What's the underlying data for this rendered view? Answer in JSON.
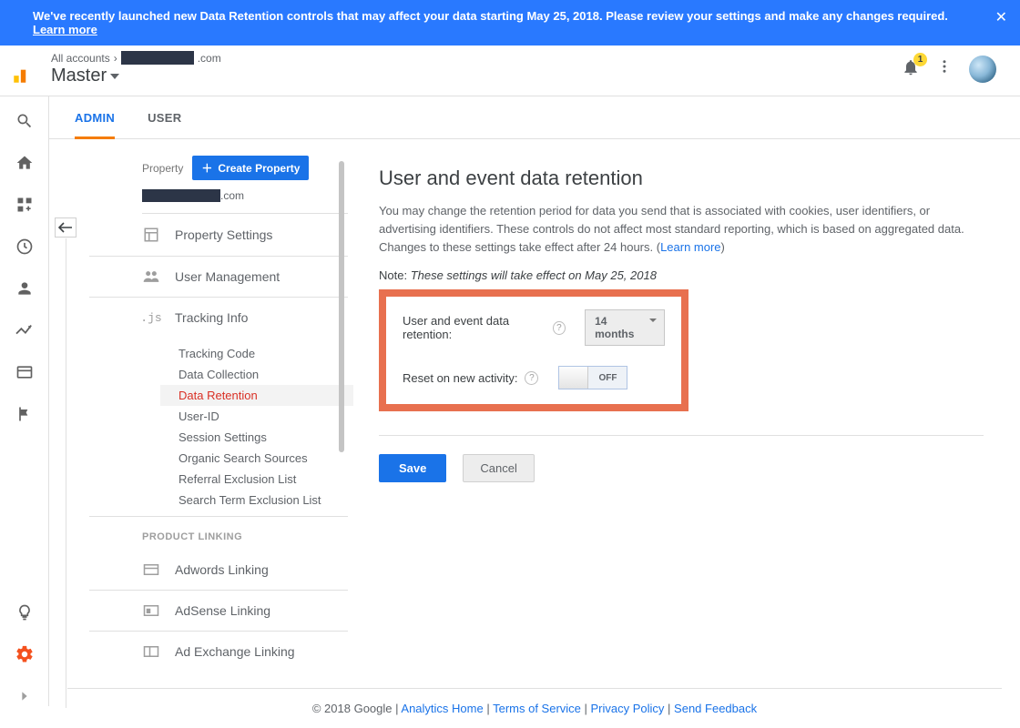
{
  "banner": {
    "text": "We've recently launched new Data Retention controls that may affect your data starting May 25, 2018. Please review your settings and make any changes required. ",
    "link": "Learn more"
  },
  "header": {
    "crumb_prefix": "All accounts",
    "crumb_suffix": ".com",
    "account": "Master",
    "notifications": "1"
  },
  "tabs": {
    "admin": "ADMIN",
    "user": "USER"
  },
  "property": {
    "label": "Property",
    "create": "Create Property",
    "domain_suffix": ".com",
    "nav": {
      "settings": "Property Settings",
      "user_mgmt": "User Management",
      "tracking": "Tracking Info",
      "tracking_sub": {
        "code": "Tracking Code",
        "collection": "Data Collection",
        "retention": "Data Retention",
        "userid": "User-ID",
        "session": "Session Settings",
        "organic": "Organic Search Sources",
        "referral": "Referral Exclusion List",
        "searchterm": "Search Term Exclusion List"
      },
      "section_linking": "PRODUCT LINKING",
      "adwords": "Adwords Linking",
      "adsense": "AdSense Linking",
      "adexchange": "Ad Exchange Linking"
    }
  },
  "content": {
    "title": "User and event data retention",
    "lead_a": "You may change the retention period for data you send that is associated with cookies, user identifiers, or advertising identifiers. These controls do not affect most standard reporting, which is based on aggregated data. Changes to these settings take effect after 24 hours. (",
    "learn_more": "Learn more",
    "lead_b": ")",
    "note_label": "Note: ",
    "note_text": "These settings will take effect on May 25, 2018",
    "row1_label": "User and event data retention:",
    "row1_value": "14 months",
    "row2_label": "Reset on new activity:",
    "row2_value": "OFF",
    "save": "Save",
    "cancel": "Cancel"
  },
  "footer": {
    "copyright": "© 2018 Google",
    "sep": " | ",
    "home": "Analytics Home",
    "tos": "Terms of Service",
    "privacy": "Privacy Policy",
    "feedback": "Send Feedback"
  }
}
